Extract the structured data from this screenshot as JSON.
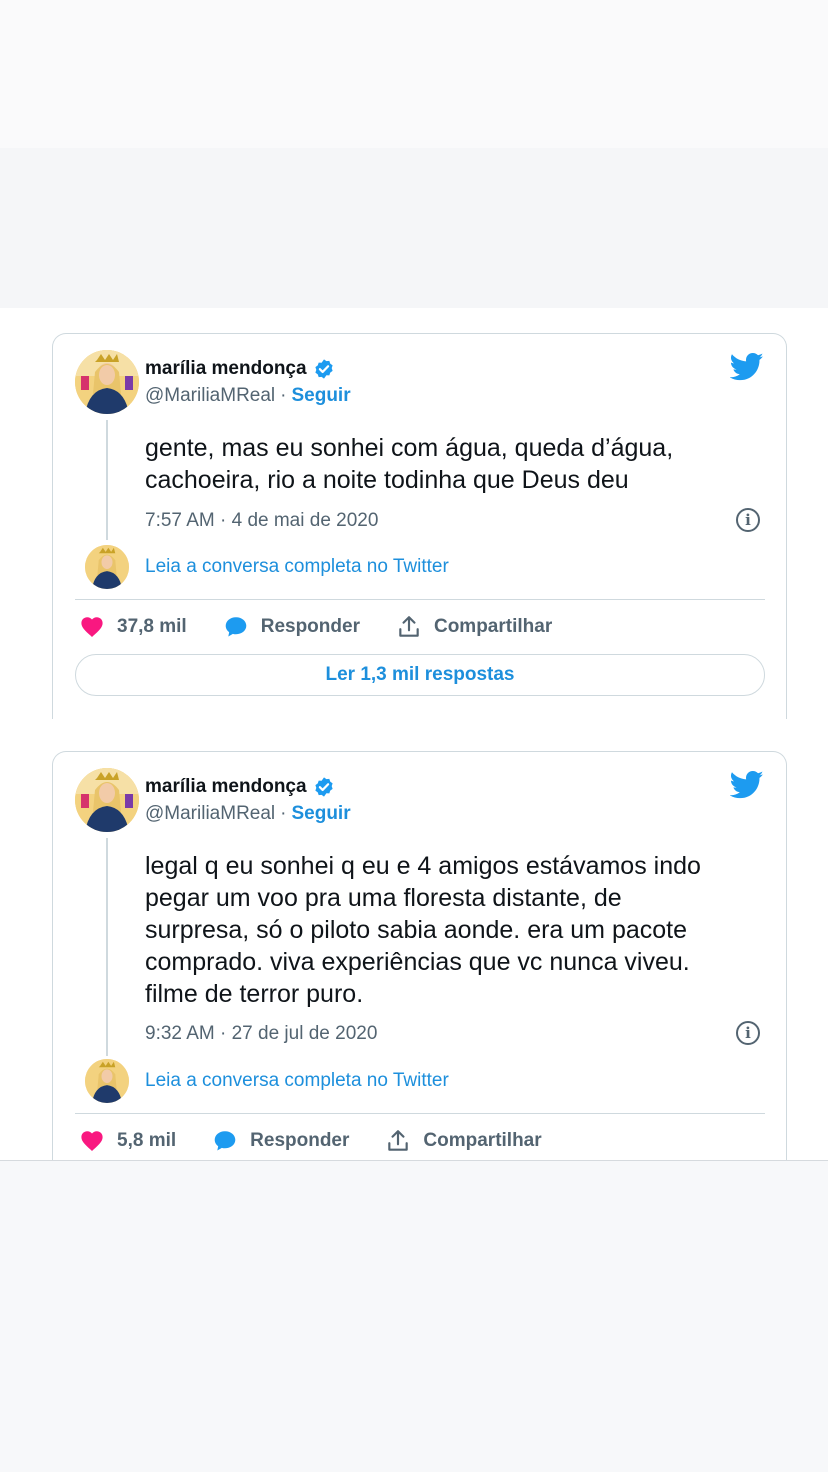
{
  "tweets": [
    {
      "author_name": "marília mendonça",
      "handle": "@MariliaMReal",
      "separator": "·",
      "follow_label": "Seguir",
      "text": "gente, mas eu sonhei com água, queda d’água,\ncachoeira, rio a noite todinha que Deus deu",
      "timestamp": "7:57 AM · 4 de mai de 2020",
      "conversation_link": "Leia a conversa completa no Twitter",
      "likes": "37,8 mil",
      "reply_label": "Responder",
      "share_label": "Compartilhar",
      "read_replies_label": "Ler 1,3 mil respostas"
    },
    {
      "author_name": "marília mendonça",
      "handle": "@MariliaMReal",
      "separator": "·",
      "follow_label": "Seguir",
      "text": "legal q eu sonhei q eu e 4 amigos estávamos indo\npegar um voo pra uma floresta distante, de\nsurpresa, só o piloto sabia aonde. era um pacote\ncomprado. viva experiências que vc nunca viveu.\nfilme de terror puro.",
      "timestamp": "9:32 AM · 27 de jul de 2020",
      "conversation_link": "Leia a conversa completa no Twitter",
      "likes": "5,8 mil",
      "reply_label": "Responder",
      "share_label": "Compartilhar"
    }
  ],
  "icons": {
    "verified": "verified-badge-icon",
    "brand": "twitter-bird-icon",
    "info": "info-icon",
    "like": "heart-icon",
    "reply": "speech-bubble-icon",
    "share": "share-upload-icon"
  },
  "colors": {
    "accent": "#1d8fdc",
    "like": "#f91880",
    "text_secondary": "#536471",
    "border": "#cfd9de"
  }
}
